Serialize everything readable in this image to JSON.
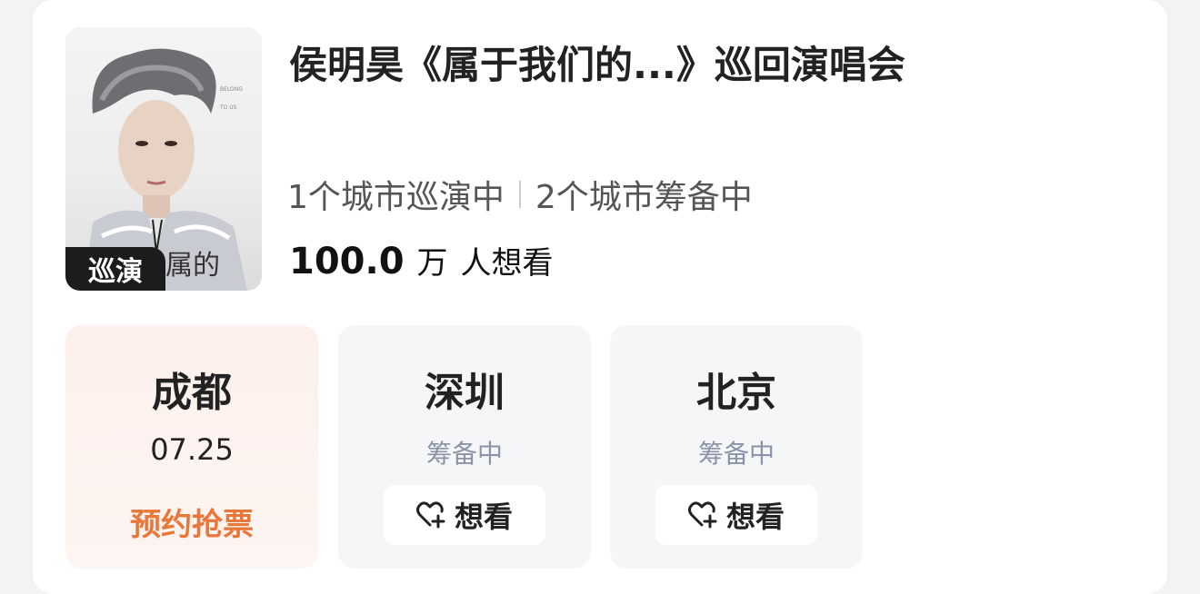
{
  "event": {
    "title": "侯明昊《属于我们的...》巡回演唱会",
    "poster_badge": "巡演",
    "tour_status": "1个城市巡演中",
    "prep_status": "2个城市筹备中",
    "want_count": "100.0",
    "want_unit": "万",
    "want_text": "人想看"
  },
  "cities": [
    {
      "name": "成都",
      "date": "07.25",
      "action": "预约抢票",
      "active": true
    },
    {
      "name": "深圳",
      "status": "筹备中",
      "button": "想看",
      "active": false
    },
    {
      "name": "北京",
      "status": "筹备中",
      "button": "想看",
      "active": false
    }
  ],
  "colors": {
    "accent_orange": "#e8773a",
    "status_gray": "#8a93a8",
    "active_bg": "#fdf0ec"
  }
}
